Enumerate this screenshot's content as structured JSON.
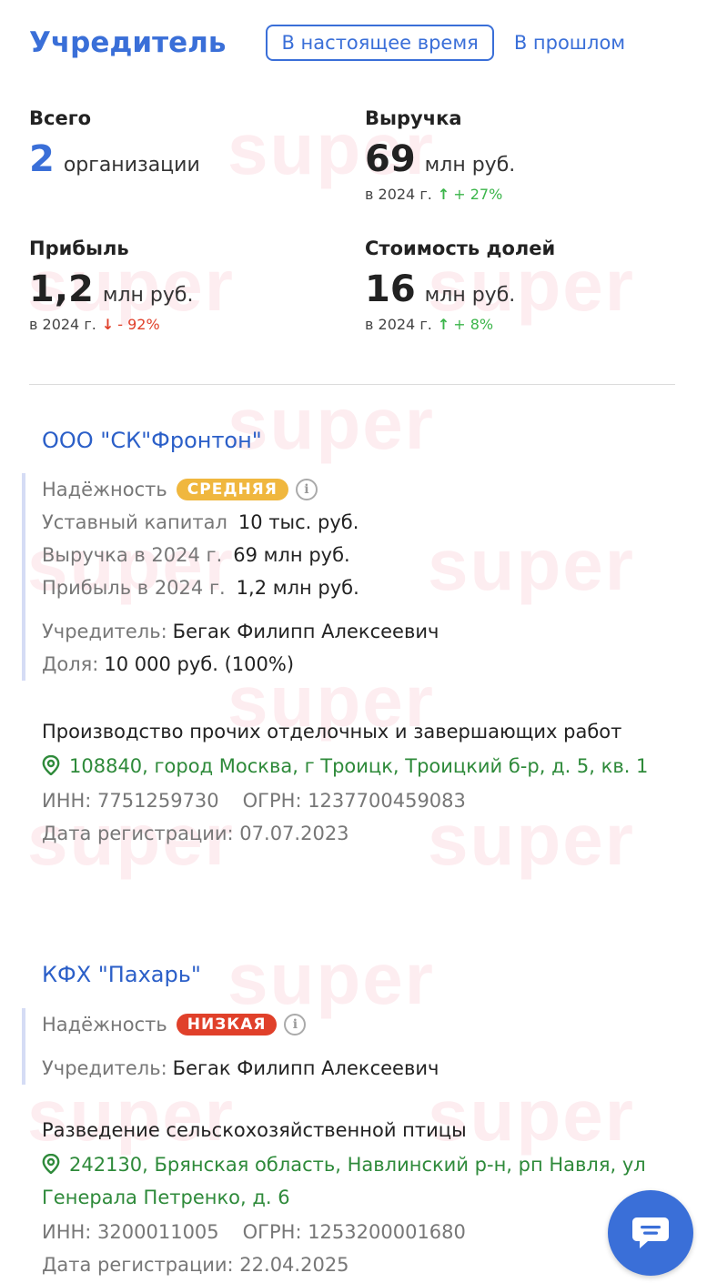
{
  "header": {
    "title": "Учредитель",
    "tab_current": "В настоящее время",
    "tab_past": "В прошлом"
  },
  "stats": {
    "total": {
      "label": "Всего",
      "value": "2",
      "unit": "организации"
    },
    "revenue": {
      "label": "Выручка",
      "value": "69",
      "unit": "млн руб.",
      "year": "в 2024 г.",
      "change": "+ 27%",
      "direction": "up"
    },
    "profit": {
      "label": "Прибыль",
      "value": "1,2",
      "unit": "млн руб.",
      "year": "в 2024 г.",
      "change": "- 92%",
      "direction": "down"
    },
    "shares": {
      "label": "Стоимость долей",
      "value": "16",
      "unit": "млн руб.",
      "year": "в 2024 г.",
      "change": "+ 8%",
      "direction": "up"
    }
  },
  "orgs": [
    {
      "name": "ООО \"СК\"Фронтон\"",
      "reliability_label": "Надёжность",
      "reliability": "СРЕДНЯЯ",
      "capital_label": "Уставный капитал",
      "capital": "10 тыс. руб.",
      "revenue_label": "Выручка в 2024 г.",
      "revenue": "69 млн руб.",
      "profit_label": "Прибыль в 2024 г.",
      "profit": "1,2 млн руб.",
      "founder_label": "Учредитель:",
      "founder": "Бегак Филипп Алексеевич",
      "share_label": "Доля:",
      "share": "10 000 руб. (100%)",
      "activity": "Производство прочих отделочных и завершающих работ",
      "address": "108840, город Москва, г Троицк, Троицкий б-р, д. 5, кв. 1",
      "inn": "ИНН: 7751259730",
      "ogrn": "ОГРН: 1237700459083",
      "reg_date": "Дата регистрации: 07.07.2023"
    },
    {
      "name": "КФХ \"Пахарь\"",
      "reliability_label": "Надёжность",
      "reliability": "НИЗКАЯ",
      "founder_label": "Учредитель:",
      "founder": "Бегак Филипп Алексеевич",
      "activity": "Разведение сельскохозяйственной птицы",
      "address": "242130, Брянская область, Навлинский р-н, рп Навля, ул Генерала Петренко, д. 6",
      "inn": "ИНН: 3200011005",
      "ogrn": "ОГРН: 1253200001680",
      "reg_date": "Дата регистрации: 22.04.2025"
    }
  ],
  "watermark": "super",
  "colors": {
    "accent": "#3a6fd8",
    "green": "#3bb54a",
    "red": "#e0402a",
    "badge_mid": "#f0b73e",
    "badge_low": "#e0402a",
    "address": "#2e8a3a"
  },
  "icons": {
    "pin": "location-pin-icon",
    "info": "info-icon",
    "chat": "chat-icon"
  }
}
